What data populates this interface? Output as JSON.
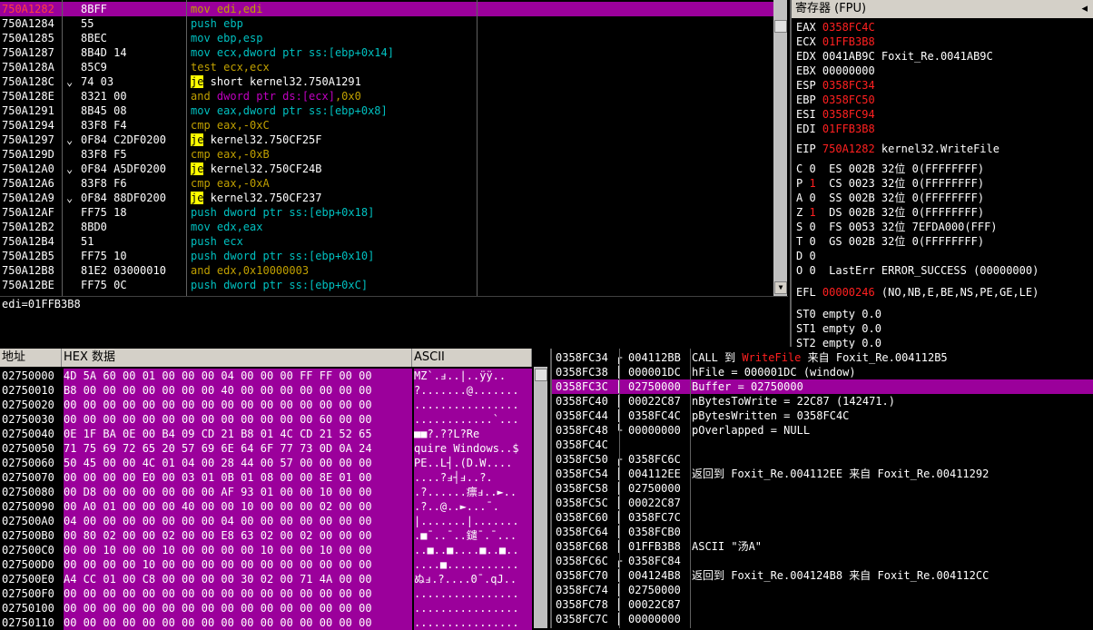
{
  "disasm": {
    "rows": [
      {
        "addr": "750A1282",
        "bytes": "8BFF",
        "arrow": "",
        "instr": [
          {
            "t": "mov ",
            "c": "m-olive"
          },
          {
            "t": "edi,edi",
            "c": "m-olive"
          }
        ]
      },
      {
        "addr": "750A1284",
        "bytes": "55",
        "arrow": "",
        "instr": [
          {
            "t": "push ",
            "c": "m-cyan"
          },
          {
            "t": "ebp",
            "c": "m-cyan"
          }
        ]
      },
      {
        "addr": "750A1285",
        "bytes": "8BEC",
        "arrow": "",
        "instr": [
          {
            "t": "mov ",
            "c": "m-cyan"
          },
          {
            "t": "ebp,esp",
            "c": "m-cyan"
          }
        ]
      },
      {
        "addr": "750A1287",
        "bytes": "8B4D 14",
        "arrow": "",
        "instr": [
          {
            "t": "mov ",
            "c": "m-cyan"
          },
          {
            "t": "ecx,dword ptr ss:[ebp+0x14]",
            "c": "m-cyan"
          }
        ]
      },
      {
        "addr": "750A128A",
        "bytes": "85C9",
        "arrow": "",
        "instr": [
          {
            "t": "test ",
            "c": "m-olive"
          },
          {
            "t": "ecx,ecx",
            "c": "m-olive"
          }
        ]
      },
      {
        "addr": "750A128C",
        "bytes": "74 03",
        "arrow": "⌄",
        "instr": [
          {
            "t": "je",
            "c": "m-jmp"
          },
          {
            "t": " short kernel32.750A1291",
            "c": "m-white"
          }
        ]
      },
      {
        "addr": "750A128E",
        "bytes": "8321 00",
        "arrow": "",
        "instr": [
          {
            "t": "and ",
            "c": "m-olive"
          },
          {
            "t": "dword ptr ds:[ecx]",
            "c": "m-mag"
          },
          {
            "t": ",0x0",
            "c": "m-olive"
          }
        ]
      },
      {
        "addr": "750A1291",
        "bytes": "8B45 08",
        "arrow": "",
        "instr": [
          {
            "t": "mov ",
            "c": "m-cyan"
          },
          {
            "t": "eax,dword ptr ss:[ebp+0x8]",
            "c": "m-cyan"
          }
        ]
      },
      {
        "addr": "750A1294",
        "bytes": "83F8 F4",
        "arrow": "",
        "instr": [
          {
            "t": "cmp ",
            "c": "m-olive"
          },
          {
            "t": "eax,-0xC",
            "c": "m-olive"
          }
        ]
      },
      {
        "addr": "750A1297",
        "bytes": "0F84 C2DF0200",
        "arrow": "⌄",
        "instr": [
          {
            "t": "je",
            "c": "m-jmp"
          },
          {
            "t": " kernel32.750CF25F",
            "c": "m-white"
          }
        ]
      },
      {
        "addr": "750A129D",
        "bytes": "83F8 F5",
        "arrow": "",
        "instr": [
          {
            "t": "cmp ",
            "c": "m-olive"
          },
          {
            "t": "eax,-0xB",
            "c": "m-olive"
          }
        ]
      },
      {
        "addr": "750A12A0",
        "bytes": "0F84 A5DF0200",
        "arrow": "⌄",
        "instr": [
          {
            "t": "je",
            "c": "m-jmp"
          },
          {
            "t": " kernel32.750CF24B",
            "c": "m-white"
          }
        ]
      },
      {
        "addr": "750A12A6",
        "bytes": "83F8 F6",
        "arrow": "",
        "instr": [
          {
            "t": "cmp ",
            "c": "m-olive"
          },
          {
            "t": "eax,-0xA",
            "c": "m-olive"
          }
        ]
      },
      {
        "addr": "750A12A9",
        "bytes": "0F84 88DF0200",
        "arrow": "⌄",
        "instr": [
          {
            "t": "je",
            "c": "m-jmp"
          },
          {
            "t": " kernel32.750CF237",
            "c": "m-white"
          }
        ]
      },
      {
        "addr": "750A12AF",
        "bytes": "FF75 18",
        "arrow": "",
        "instr": [
          {
            "t": "push ",
            "c": "m-cyan"
          },
          {
            "t": "dword ptr ss:[ebp+0x18]",
            "c": "m-cyan"
          }
        ]
      },
      {
        "addr": "750A12B2",
        "bytes": "8BD0",
        "arrow": "",
        "instr": [
          {
            "t": "mov ",
            "c": "m-cyan"
          },
          {
            "t": "edx,eax",
            "c": "m-cyan"
          }
        ]
      },
      {
        "addr": "750A12B4",
        "bytes": "51",
        "arrow": "",
        "instr": [
          {
            "t": "push ",
            "c": "m-cyan"
          },
          {
            "t": "ecx",
            "c": "m-cyan"
          }
        ]
      },
      {
        "addr": "750A12B5",
        "bytes": "FF75 10",
        "arrow": "",
        "instr": [
          {
            "t": "push ",
            "c": "m-cyan"
          },
          {
            "t": "dword ptr ss:[ebp+0x10]",
            "c": "m-cyan"
          }
        ]
      },
      {
        "addr": "750A12B8",
        "bytes": "81E2 03000010",
        "arrow": "",
        "instr": [
          {
            "t": "and ",
            "c": "m-olive"
          },
          {
            "t": "edx,0x10000003",
            "c": "m-olive"
          }
        ]
      },
      {
        "addr": "750A12BE",
        "bytes": "FF75 0C",
        "arrow": "",
        "instr": [
          {
            "t": "push ",
            "c": "m-cyan"
          },
          {
            "t": "dword ptr ss:[ebp+0xC]",
            "c": "m-cyan"
          }
        ]
      }
    ],
    "selected_row": 0
  },
  "infobar": {
    "text": "edi=01FFB3B8"
  },
  "registers": {
    "title": "寄存器 (FPU)",
    "title_arrows": "◂",
    "gp": [
      {
        "name": "EAX",
        "value": "0358FC4C",
        "changed": true,
        "comment": ""
      },
      {
        "name": "ECX",
        "value": "01FFB3B8",
        "changed": true,
        "comment": ""
      },
      {
        "name": "EDX",
        "value": "0041AB9C",
        "changed": false,
        "comment": "Foxit_Re.0041AB9C"
      },
      {
        "name": "EBX",
        "value": "00000000",
        "changed": false,
        "comment": ""
      },
      {
        "name": "ESP",
        "value": "0358FC34",
        "changed": true,
        "comment": ""
      },
      {
        "name": "EBP",
        "value": "0358FC50",
        "changed": true,
        "comment": ""
      },
      {
        "name": "ESI",
        "value": "0358FC94",
        "changed": true,
        "comment": ""
      },
      {
        "name": "EDI",
        "value": "01FFB3B8",
        "changed": true,
        "comment": ""
      }
    ],
    "eip": {
      "name": "EIP",
      "value": "750A1282",
      "comment": "kernel32.WriteFile"
    },
    "flags": [
      {
        "f": "C",
        "v": "0",
        "vred": false,
        "seg": "ES 002B 32位 0(FFFFFFFF)"
      },
      {
        "f": "P",
        "v": "1",
        "vred": true,
        "seg": "CS 0023 32位 0(FFFFFFFF)"
      },
      {
        "f": "A",
        "v": "0",
        "vred": false,
        "seg": "SS 002B 32位 0(FFFFFFFF)"
      },
      {
        "f": "Z",
        "v": "1",
        "vred": true,
        "seg": "DS 002B 32位 0(FFFFFFFF)"
      },
      {
        "f": "S",
        "v": "0",
        "vred": false,
        "seg": "FS 0053 32位 7EFDA000(FFF)"
      },
      {
        "f": "T",
        "v": "0",
        "vred": false,
        "seg": "GS 002B 32位 0(FFFFFFFF)"
      },
      {
        "f": "D",
        "v": "0",
        "vred": false,
        "seg": ""
      },
      {
        "f": "O",
        "v": "0",
        "vred": false,
        "seg": "LastErr ERROR_SUCCESS (00000000)"
      }
    ],
    "efl": {
      "name": "EFL",
      "value": "00000246",
      "comment": "(NO,NB,E,BE,NS,PE,GE,LE)"
    },
    "fpu": [
      "ST0 empty 0.0",
      "ST1 empty 0.0",
      "ST2 empty 0.0"
    ]
  },
  "dump": {
    "headers": {
      "addr": "地址",
      "hex": "HEX 数据",
      "ascii": "ASCII"
    },
    "rows": [
      {
        "addr": "02750000",
        "hex": "4D 5A 60 00 01 00 00 00 04 00 00 00 FF FF 00 00",
        "ascii": "MZ`.ⅎ..|..ÿÿ.."
      },
      {
        "addr": "02750010",
        "hex": "B8 00 00 00 00 00 00 00 40 00 00 00 00 00 00 00",
        "ascii": "?.......@......."
      },
      {
        "addr": "02750020",
        "hex": "00 00 00 00 00 00 00 00 00 00 00 00 00 00 00 00",
        "ascii": "................"
      },
      {
        "addr": "02750030",
        "hex": "00 00 00 00 00 00 00 00 00 00 00 00 00 60 00 00",
        "ascii": "............`..."
      },
      {
        "addr": "02750040",
        "hex": "0E 1F BA 0E 00 B4 09 CD 21 B8 01 4C CD 21 52 65",
        "ascii": "■■?.??L?Re"
      },
      {
        "addr": "02750050",
        "hex": "71 75 69 72 65 20 57 69 6E 64 6F 77 73 0D 0A 24",
        "ascii": "quire Windows..$"
      },
      {
        "addr": "02750060",
        "hex": "50 45 00 00 4C 01 04 00 28 44 00 57 00 00 00 00",
        "ascii": "PE..L┤.(D.W...."
      },
      {
        "addr": "02750070",
        "hex": "00 00 00 00 E0 00 03 01 0B 01 08 00 00 8E 01 00",
        "ascii": "....?ⅎ┤ⅎ..?."
      },
      {
        "addr": "02750080",
        "hex": "00 D8 00 00 00 00 00 00 AF 93 01 00 00 10 00 00",
        "ascii": ".?......瘭ⅎ..►.."
      },
      {
        "addr": "02750090",
        "hex": "00 A0 01 00 00 00 40 00 00 10 00 00 00 02 00 00",
        "ascii": ".?..@..►...¯."
      },
      {
        "addr": "027500A0",
        "hex": "04 00 00 00 00 00 00 00 04 00 00 00 00 00 00 00",
        "ascii": "|.......|......."
      },
      {
        "addr": "027500B0",
        "hex": "00 80 02 00 00 02 00 00 E8 63 02 00 02 00 00 00",
        "ascii": ".■¯..¯..鑓¯.¯..."
      },
      {
        "addr": "027500C0",
        "hex": "00 00 10 00 00 10 00 00 00 00 10 00 00 10 00 00",
        "ascii": "..■..■....■..■.."
      },
      {
        "addr": "027500D0",
        "hex": "00 00 00 00 10 00 00 00 00 00 00 00 00 00 00 00",
        "ascii": "....■..........."
      },
      {
        "addr": "027500E0",
        "hex": "A4 CC 01 00 C8 00 00 00 00 30 02 00 71 4A 00 00",
        "ascii": "ぬⅎ.?....0¯.qJ.."
      },
      {
        "addr": "027500F0",
        "hex": "00 00 00 00 00 00 00 00 00 00 00 00 00 00 00 00",
        "ascii": "................"
      },
      {
        "addr": "02750100",
        "hex": "00 00 00 00 00 00 00 00 00 00 00 00 00 00 00 00",
        "ascii": "................"
      },
      {
        "addr": "02750110",
        "hex": "00 00 00 00 00 00 00 00 00 00 00 00 00 00 00 00",
        "ascii": "................"
      }
    ]
  },
  "stack": {
    "rows": [
      {
        "addr": "0358FC34",
        "val": "004112BB",
        "br": "┌",
        "com": [
          {
            "t": "CALL 到 ",
            "c": "w"
          },
          {
            "t": "WriteFile",
            "c": "r"
          },
          {
            "t": " 来自 Foxit_Re.004112B5",
            "c": "w"
          }
        ]
      },
      {
        "addr": "0358FC38",
        "val": "000001DC",
        "br": "│",
        "com": [
          {
            "t": "hFile = 000001DC (window)",
            "c": "w"
          }
        ]
      },
      {
        "addr": "0358FC3C",
        "val": "02750000",
        "br": "│",
        "com": [
          {
            "t": "Buffer = 02750000",
            "c": "w"
          }
        ],
        "sel": true
      },
      {
        "addr": "0358FC40",
        "val": "00022C87",
        "br": "│",
        "com": [
          {
            "t": "nBytesToWrite = 22C87 (142471.)",
            "c": "w"
          }
        ]
      },
      {
        "addr": "0358FC44",
        "val": "0358FC4C",
        "br": "│",
        "com": [
          {
            "t": "pBytesWritten = 0358FC4C",
            "c": "w"
          }
        ]
      },
      {
        "addr": "0358FC48",
        "val": "00000000",
        "br": "└",
        "com": [
          {
            "t": "pOverlapped = NULL",
            "c": "w"
          }
        ]
      },
      {
        "addr": "0358FC4C",
        "val": "",
        "br": "",
        "com": []
      },
      {
        "addr": "0358FC50",
        "val": "0358FC6C",
        "br": "┌",
        "com": []
      },
      {
        "addr": "0358FC54",
        "val": "004112EE",
        "br": "│",
        "com": [
          {
            "t": "返回到 Foxit_Re.004112EE 来自 Foxit_Re.00411292",
            "c": "w"
          }
        ]
      },
      {
        "addr": "0358FC58",
        "val": "02750000",
        "br": "│",
        "com": []
      },
      {
        "addr": "0358FC5C",
        "val": "00022C87",
        "br": "│",
        "com": []
      },
      {
        "addr": "0358FC60",
        "val": "0358FC7C",
        "br": "│",
        "com": []
      },
      {
        "addr": "0358FC64",
        "val": "0358FCB0",
        "br": "│",
        "com": []
      },
      {
        "addr": "0358FC68",
        "val": "01FFB3B8",
        "br": "│",
        "com": [
          {
            "t": "ASCII \"汤A\"",
            "c": "w"
          }
        ]
      },
      {
        "addr": "0358FC6C",
        "val": "0358FC84",
        "br": "┌",
        "com": []
      },
      {
        "addr": "0358FC70",
        "val": "004124B8",
        "br": "│",
        "com": [
          {
            "t": "返回到 Foxit_Re.004124B8 来自 Foxit_Re.004112CC",
            "c": "w"
          }
        ]
      },
      {
        "addr": "0358FC74",
        "val": "02750000",
        "br": "│",
        "com": []
      },
      {
        "addr": "0358FC78",
        "val": "00022C87",
        "br": "│",
        "com": []
      },
      {
        "addr": "0358FC7C",
        "val": "00000000",
        "br": "│",
        "com": []
      }
    ]
  }
}
